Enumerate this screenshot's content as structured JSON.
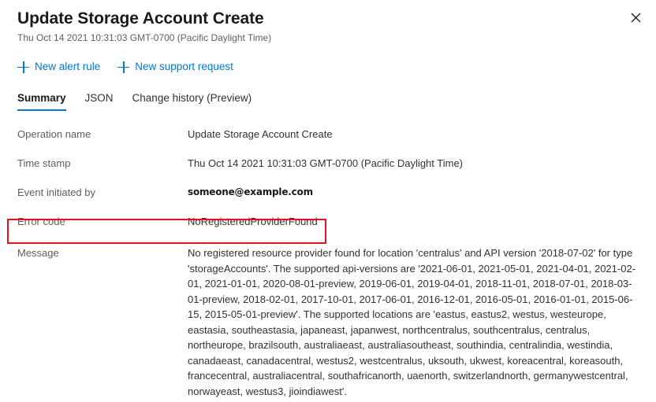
{
  "header": {
    "title": "Update Storage Account Create",
    "subtitle": "Thu Oct 14 2021 10:31:03 GMT-0700 (Pacific Daylight Time)",
    "close_icon": "close-icon"
  },
  "commandbar": {
    "actions": [
      {
        "label": "New alert rule",
        "icon": "plus-icon"
      },
      {
        "label": "New support request",
        "icon": "plus-icon"
      }
    ]
  },
  "tabs": [
    {
      "label": "Summary",
      "active": true
    },
    {
      "label": "JSON",
      "active": false
    },
    {
      "label": "Change history (Preview)",
      "active": false
    }
  ],
  "details": [
    {
      "label": "Operation name",
      "value": "Update Storage Account Create"
    },
    {
      "label": "Time stamp",
      "value": "Thu Oct 14 2021 10:31:03 GMT-0700 (Pacific Daylight Time)"
    },
    {
      "label": "Event initiated by",
      "value": "someone@example.com"
    },
    {
      "label": "Error code",
      "value": "NoRegisteredProviderFound"
    },
    {
      "label": "Message",
      "value": "No registered resource provider found for location 'centralus' and API version '2018-07-02' for type 'storageAccounts'. The supported api-versions are '2021-06-01, 2021-05-01, 2021-04-01, 2021-02-01, 2021-01-01, 2020-08-01-preview, 2019-06-01, 2019-04-01, 2018-11-01, 2018-07-01, 2018-03-01-preview, 2018-02-01, 2017-10-01, 2017-06-01, 2016-12-01, 2016-05-01, 2016-01-01, 2015-06-15, 2015-05-01-preview'. The supported locations are 'eastus, eastus2, westus, westeurope, eastasia, southeastasia, japaneast, japanwest, northcentralus, southcentralus, centralus, northeurope, brazilsouth, australiaeast, australiasoutheast, southindia, centralindia, westindia, canadaeast, canadacentral, westus2, westcentralus, uksouth, ukwest, koreacentral, koreasouth, francecentral, australiacentral, southafricanorth, uaenorth, switzerlandnorth, germanywestcentral, norwayeast, westus3, jioindiawest'."
    }
  ],
  "annotation": {
    "target": "error-code-row",
    "color": "#e81123"
  },
  "colors": {
    "accent": "#0078d4",
    "label": "#605e5c",
    "value": "#323130",
    "annotation": "#e81123"
  }
}
